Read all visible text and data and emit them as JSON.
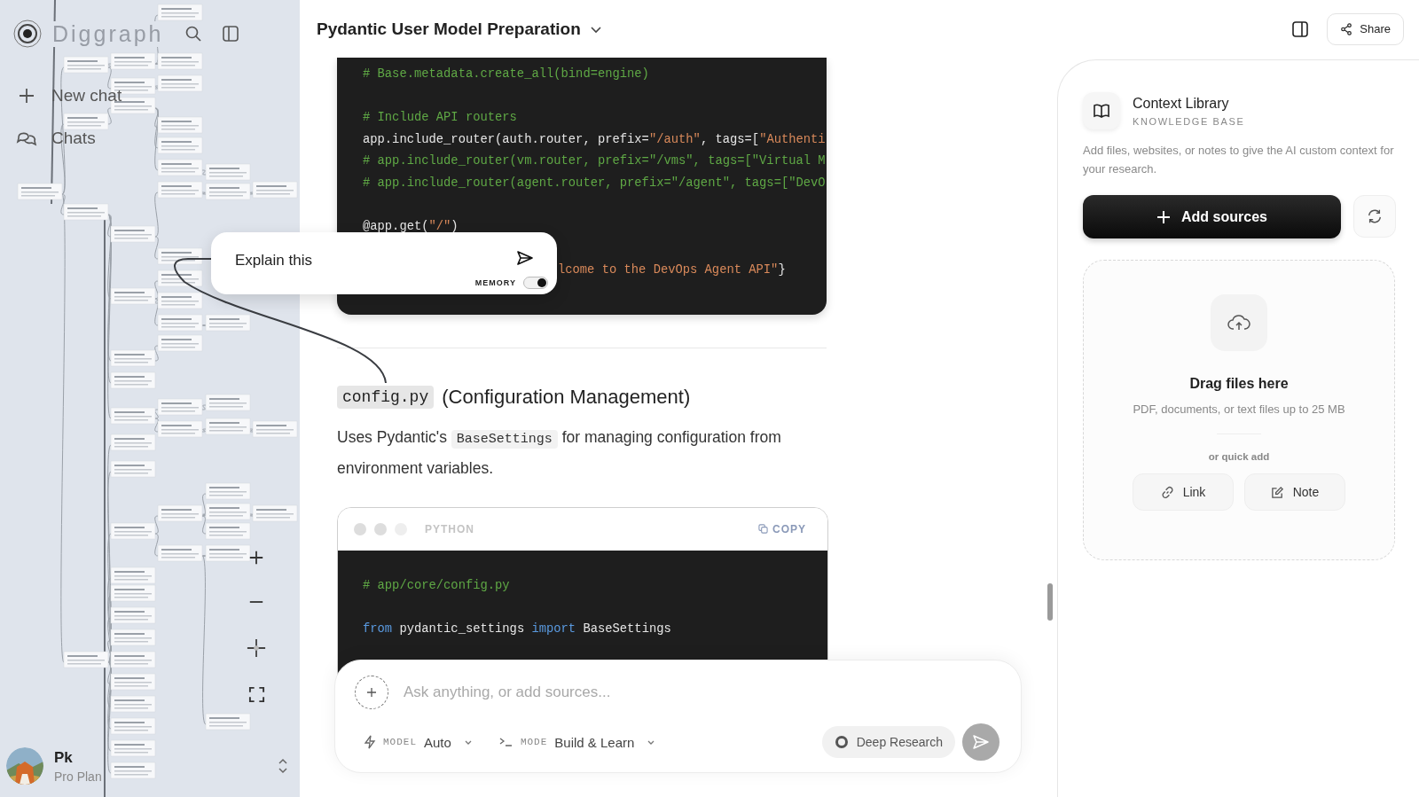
{
  "sidebar": {
    "brand": "Diggraph",
    "nav": [
      {
        "label": "New chat"
      },
      {
        "label": "Chats"
      }
    ],
    "user": {
      "name": "Pk",
      "plan": "Pro Plan"
    }
  },
  "header": {
    "title": "Pydantic User Model Preparation",
    "share": "Share"
  },
  "code_block_1": {
    "lines": [
      {
        "kind": "code",
        "tokens": [
          {
            "t": "# Base.metadata.create_all(bind=engine)",
            "kind": "comment"
          }
        ]
      },
      {
        "kind": "blank"
      },
      {
        "kind": "code",
        "tokens": [
          {
            "t": "# Include API routers",
            "kind": "comment"
          }
        ]
      },
      {
        "kind": "code",
        "tokens": [
          {
            "t": "app.include_router(auth.router, prefix=",
            "kind": "plain"
          },
          {
            "t": "\"/auth\"",
            "kind": "string"
          },
          {
            "t": ", tags=[",
            "kind": "plain"
          },
          {
            "t": "\"Authenti",
            "kind": "string"
          }
        ]
      },
      {
        "kind": "code",
        "tokens": [
          {
            "t": "# app.include_router(vm.router, prefix=\"/vms\", tags=[\"Virtual M",
            "kind": "comment"
          }
        ]
      },
      {
        "kind": "code",
        "tokens": [
          {
            "t": "# app.include_router(agent.router, prefix=\"/agent\", tags=[\"DevO",
            "kind": "comment"
          }
        ]
      },
      {
        "kind": "blank"
      },
      {
        "kind": "code",
        "tokens": [
          {
            "t": "@app.get(",
            "kind": "plain"
          },
          {
            "t": "\"/\"",
            "kind": "string"
          },
          {
            "t": ")",
            "kind": "plain"
          }
        ]
      },
      {
        "kind": "blank"
      },
      {
        "kind": "partial",
        "tokens": [
          {
            "t": "lcome to the DevOps Agent API\"",
            "kind": "string"
          },
          {
            "t": "}",
            "kind": "plain"
          }
        ]
      }
    ]
  },
  "popup": {
    "value": "Explain this",
    "memory": {
      "label": "MEMORY",
      "on": true
    }
  },
  "section": {
    "file": "config.py",
    "heading": "(Configuration Management)",
    "paragraph": {
      "before": "Uses Pydantic's",
      "code": "BaseSettings",
      "after": "for managing configuration from environment variables."
    }
  },
  "code_block_2": {
    "language": "PYTHON",
    "copy": "COPY",
    "lines": [
      {
        "kind": "code",
        "tokens": [
          {
            "t": "# app/core/config.py",
            "kind": "comment"
          }
        ]
      },
      {
        "kind": "blank"
      },
      {
        "kind": "code",
        "tokens": [
          {
            "t": "from",
            "kind": "keyword"
          },
          {
            "t": " pydantic_settings ",
            "kind": "plain"
          },
          {
            "t": "import",
            "kind": "keyword"
          },
          {
            "t": " BaseSettings",
            "kind": "plain"
          }
        ]
      }
    ]
  },
  "composer": {
    "placeholder": "Ask anything, or add sources...",
    "model_label": "MODEL",
    "model": "Auto",
    "mode_label": "MODE",
    "mode": "Build & Learn",
    "deep_research": {
      "label": "Deep Research",
      "on": false
    }
  },
  "library": {
    "title": "Context Library",
    "subtitle": "KNOWLEDGE BASE",
    "description": "Add files, websites, or notes to give the AI custom context for your research.",
    "add": "Add sources",
    "drop_title": "Drag files here",
    "drop_hint": "PDF, documents, or text files up to 25 MB",
    "quick_label": "or quick add",
    "quick": [
      {
        "label": "Link"
      },
      {
        "label": "Note"
      }
    ]
  }
}
